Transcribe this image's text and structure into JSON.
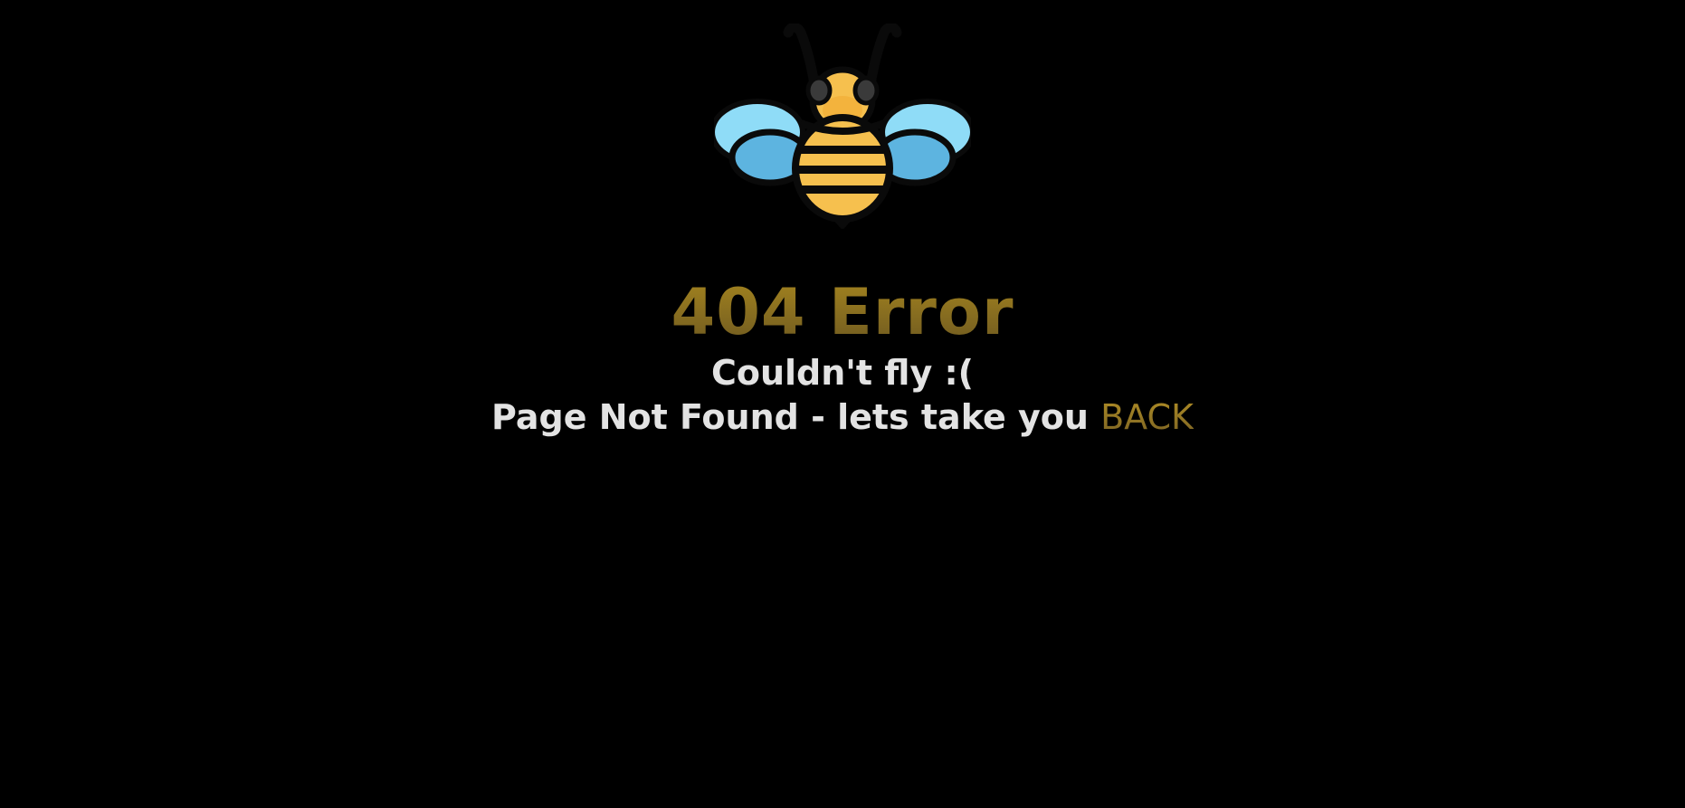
{
  "error": {
    "title": "404 Error",
    "subtitle": "Couldn't fly :(",
    "message": "Page Not Found - lets take you ",
    "back_link": "BACK"
  },
  "illustration": {
    "icon": "bee-icon"
  },
  "colors": {
    "background": "#000000",
    "accent_gold": "#9b7d28",
    "text_light": "#e3e3e3",
    "bee_yellow": "#f6c04e",
    "wing_light": "#8fdcf7",
    "wing_dark": "#5db4e0"
  }
}
